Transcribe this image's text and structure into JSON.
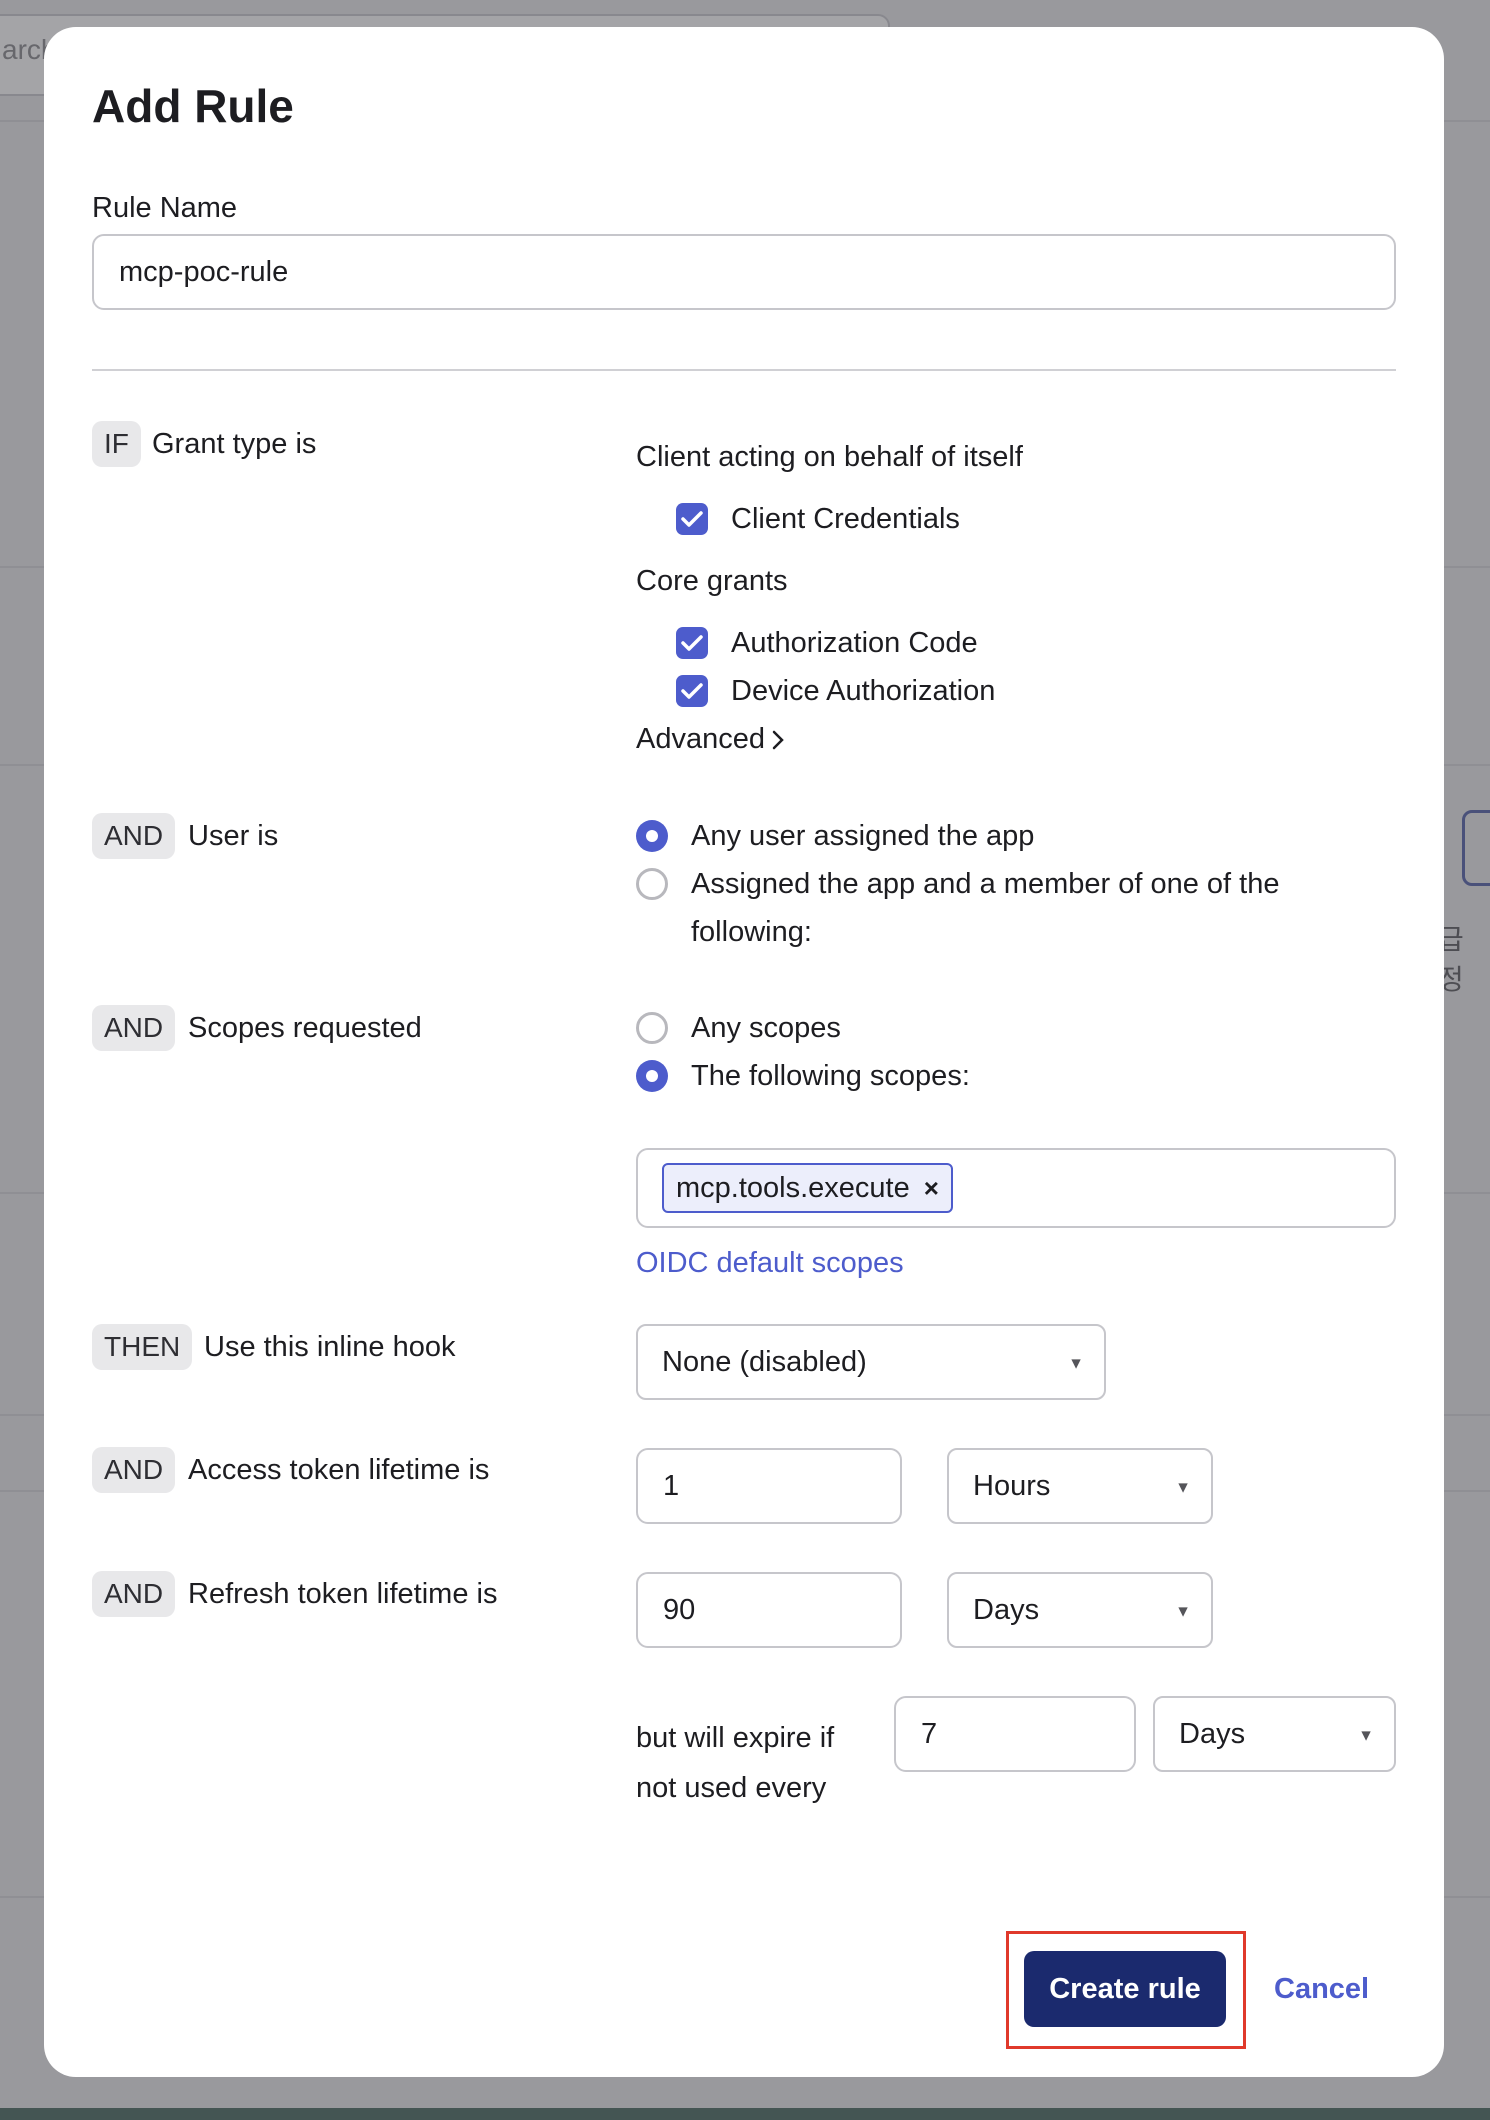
{
  "background": {
    "search_text": "arch",
    "right_text": "급 정"
  },
  "modal": {
    "title": "Add Rule",
    "rule_name_label": "Rule Name",
    "rule_name_value": "mcp-poc-rule"
  },
  "conditions": {
    "grant": {
      "tag": "IF",
      "label": "Grant type is",
      "client_heading": "Client acting on behalf of itself",
      "client_credentials": "Client Credentials",
      "core_heading": "Core grants",
      "authorization_code": "Authorization Code",
      "device_authorization": "Device Authorization",
      "advanced": "Advanced"
    },
    "user": {
      "tag": "AND",
      "label": "User is",
      "option_any": "Any user assigned the app",
      "option_member_line1": "Assigned the app and a member of one of the",
      "option_member_line2": "following:",
      "selected": "option_any"
    },
    "scopes": {
      "tag": "AND",
      "label": "Scopes requested",
      "option_any": "Any scopes",
      "option_following": "The following scopes:",
      "selected": "option_following",
      "chip": "mcp.tools.execute",
      "chip_remove": "×",
      "oidc_link": "OIDC default scopes"
    },
    "hook": {
      "tag": "THEN",
      "label": "Use this inline hook",
      "value": "None (disabled)"
    },
    "access_token": {
      "tag": "AND",
      "label": "Access token lifetime is",
      "value": "1",
      "unit": "Hours"
    },
    "refresh_token": {
      "tag": "AND",
      "label": "Refresh token lifetime is",
      "value": "90",
      "unit": "Days",
      "expire_line1": "but will expire if",
      "expire_line2": "not used every",
      "expire_value": "7",
      "expire_unit": "Days"
    }
  },
  "actions": {
    "create": "Create rule",
    "cancel": "Cancel"
  },
  "colors": {
    "accent": "#4d5ccc",
    "primary_button": "#1b2a6e",
    "highlight": "#e0392b"
  }
}
